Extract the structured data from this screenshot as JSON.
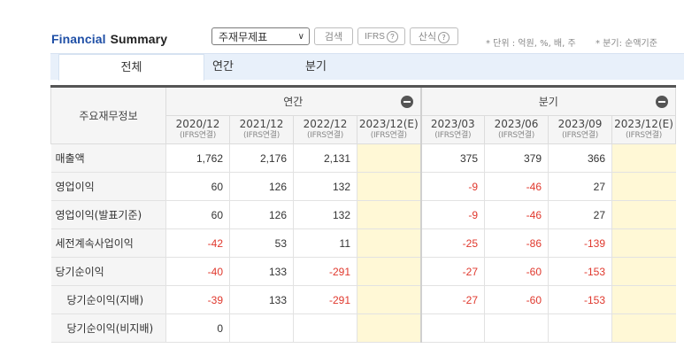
{
  "header": {
    "title_part1": "Financial",
    "title_part2": "Summary",
    "select_value": "주재무제표",
    "search_label": "검색",
    "ifrs_label": "IFRS",
    "calc_label": "산식",
    "help_mark": "?",
    "note_unit": "* 단위 : 억원, %, 배, 주",
    "note_quarter": "* 분기: 순액기준"
  },
  "tabs": [
    {
      "label": "전체",
      "active": true
    },
    {
      "label": "연간",
      "active": false
    },
    {
      "label": "분기",
      "active": false
    }
  ],
  "table": {
    "row_header": "주요재무정보",
    "annual_group": "연간",
    "quarter_group": "분기",
    "annual_cols": [
      {
        "date": "2020/12",
        "sub": "(IFRS연결)"
      },
      {
        "date": "2021/12",
        "sub": "(IFRS연결)"
      },
      {
        "date": "2022/12",
        "sub": "(IFRS연결)"
      },
      {
        "date": "2023/12(E)",
        "sub": "(IFRS연결)"
      }
    ],
    "quarter_cols": [
      {
        "date": "2023/03",
        "sub": "(IFRS연결)"
      },
      {
        "date": "2023/06",
        "sub": "(IFRS연결)"
      },
      {
        "date": "2023/09",
        "sub": "(IFRS연결)"
      },
      {
        "date": "2023/12(E)",
        "sub": "(IFRS연결)"
      }
    ],
    "rows": [
      {
        "label": "매출액",
        "indent": false,
        "values": [
          "1,762",
          "2,176",
          "2,131",
          "",
          "375",
          "379",
          "366",
          ""
        ]
      },
      {
        "label": "영업이익",
        "indent": false,
        "values": [
          "60",
          "126",
          "132",
          "",
          "-9",
          "-46",
          "27",
          ""
        ]
      },
      {
        "label": "영업이익(발표기준)",
        "indent": false,
        "values": [
          "60",
          "126",
          "132",
          "",
          "-9",
          "-46",
          "27",
          ""
        ]
      },
      {
        "label": "세전계속사업이익",
        "indent": false,
        "values": [
          "-42",
          "53",
          "11",
          "",
          "-25",
          "-86",
          "-139",
          ""
        ]
      },
      {
        "label": "당기순이익",
        "indent": false,
        "values": [
          "-40",
          "133",
          "-291",
          "",
          "-27",
          "-60",
          "-153",
          ""
        ]
      },
      {
        "label": "당기순이익(지배)",
        "indent": true,
        "values": [
          "-39",
          "133",
          "-291",
          "",
          "-27",
          "-60",
          "-153",
          ""
        ]
      },
      {
        "label": "당기순이익(비지배)",
        "indent": true,
        "values": [
          "0",
          "",
          "",
          "",
          "",
          "",
          "",
          ""
        ]
      }
    ]
  }
}
